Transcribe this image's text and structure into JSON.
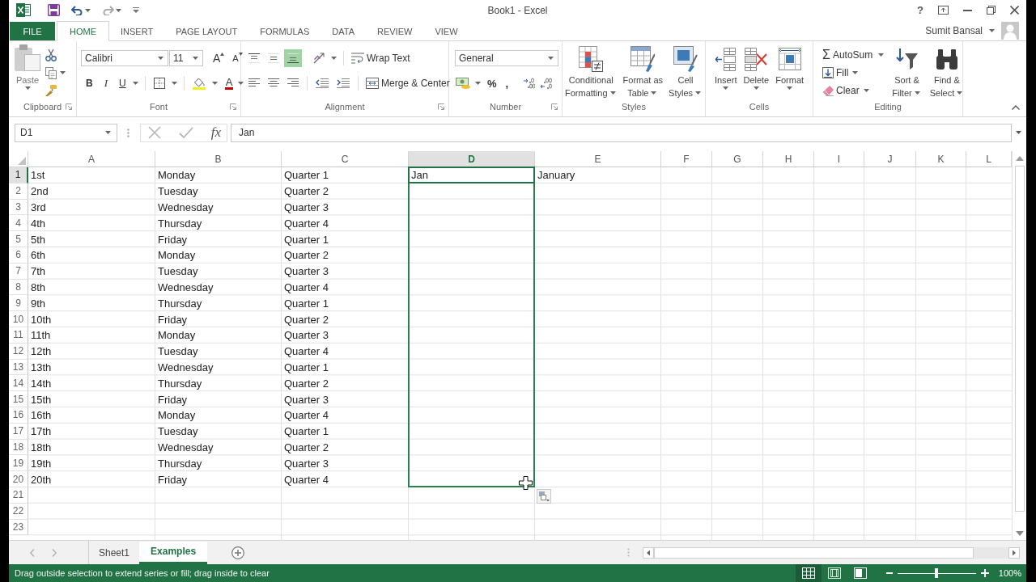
{
  "window": {
    "title": "Book1 - Excel",
    "help": "?"
  },
  "tabs": [
    {
      "label": "FILE",
      "kind": "file",
      "selected": false
    },
    {
      "label": "HOME",
      "kind": "tab",
      "selected": true
    },
    {
      "label": "INSERT",
      "kind": "tab",
      "selected": false
    },
    {
      "label": "PAGE LAYOUT",
      "kind": "tab",
      "selected": false
    },
    {
      "label": "FORMULAS",
      "kind": "tab",
      "selected": false
    },
    {
      "label": "DATA",
      "kind": "tab",
      "selected": false
    },
    {
      "label": "REVIEW",
      "kind": "tab",
      "selected": false
    },
    {
      "label": "VIEW",
      "kind": "tab",
      "selected": false
    }
  ],
  "account": {
    "name": "Sumit Bansal"
  },
  "ribbon": {
    "clipboard": {
      "label": "Clipboard",
      "paste": "Paste"
    },
    "font": {
      "label": "Font",
      "font_name": "Calibri",
      "font_size": "11",
      "grow": "A",
      "shrink": "A",
      "styles": [
        "B",
        "I",
        "U"
      ],
      "font_color": "A"
    },
    "alignment": {
      "label": "Alignment",
      "vertical": [
        {
          "kind": "top",
          "selected": false
        },
        {
          "kind": "middle",
          "selected": false
        },
        {
          "kind": "bottom",
          "selected": true
        }
      ],
      "horizontal": [
        {
          "kind": "left",
          "selected": false
        },
        {
          "kind": "center",
          "selected": false
        },
        {
          "kind": "right",
          "selected": false
        }
      ],
      "wrap_text": "Wrap Text",
      "merge": "Merge & Center"
    },
    "number": {
      "label": "Number",
      "format": "General",
      "percent": "%",
      "comma": ","
    },
    "styles": {
      "label": "Styles",
      "buttons": [
        {
          "kind": "conditional",
          "lines": [
            "Conditional",
            "Formatting"
          ]
        },
        {
          "kind": "table",
          "lines": [
            "Format as",
            "Table"
          ]
        },
        {
          "kind": "cell_styles",
          "lines": [
            "Cell",
            "Styles"
          ]
        }
      ]
    },
    "cells": {
      "label": "Cells",
      "buttons": [
        {
          "kind": "insert",
          "label": "Insert"
        },
        {
          "kind": "delete",
          "label": "Delete"
        },
        {
          "kind": "format",
          "label": "Format"
        }
      ]
    },
    "editing": {
      "label": "Editing",
      "autosum": {
        "symbol": "Σ",
        "label": "AutoSum"
      },
      "fill": "Fill",
      "clear": "Clear",
      "buttons": [
        {
          "kind": "sort",
          "lines": [
            "Sort &",
            "Filter"
          ]
        },
        {
          "kind": "find",
          "lines": [
            "Find &",
            "Select"
          ]
        }
      ]
    }
  },
  "formula_bar": {
    "name_box": "D1",
    "function_label": "fx",
    "value": "Jan"
  },
  "sheet": {
    "fill_drag": true,
    "columns": [
      {
        "header": "A",
        "selected": false
      },
      {
        "header": "B",
        "selected": false
      },
      {
        "header": "C",
        "selected": false
      },
      {
        "header": "D",
        "selected": true
      },
      {
        "header": "E",
        "selected": false
      },
      {
        "header": "F",
        "selected": false
      },
      {
        "header": "G",
        "selected": false
      },
      {
        "header": "H",
        "selected": false
      },
      {
        "header": "I",
        "selected": false
      },
      {
        "header": "J",
        "selected": false
      },
      {
        "header": "K",
        "selected": false
      },
      {
        "header": "L",
        "selected": false
      }
    ],
    "rows": [
      {
        "header": "1",
        "selected": true,
        "cells": [
          "1st",
          "Monday",
          "Quarter 1",
          "Jan",
          "January"
        ]
      },
      {
        "header": "2",
        "selected": false,
        "cells": [
          "2nd",
          "Tuesday",
          "Quarter 2"
        ]
      },
      {
        "header": "3",
        "selected": false,
        "cells": [
          "3rd",
          "Wednesday",
          "Quarter 3"
        ]
      },
      {
        "header": "4",
        "selected": false,
        "cells": [
          "4th",
          "Thursday",
          "Quarter 4"
        ]
      },
      {
        "header": "5",
        "selected": false,
        "cells": [
          "5th",
          "Friday",
          "Quarter 1"
        ]
      },
      {
        "header": "6",
        "selected": false,
        "cells": [
          "6th",
          "Monday",
          "Quarter 2"
        ]
      },
      {
        "header": "7",
        "selected": false,
        "cells": [
          "7th",
          "Tuesday",
          "Quarter 3"
        ]
      },
      {
        "header": "8",
        "selected": false,
        "cells": [
          "8th",
          "Wednesday",
          "Quarter 4"
        ]
      },
      {
        "header": "9",
        "selected": false,
        "cells": [
          "9th",
          "Thursday",
          "Quarter 1"
        ]
      },
      {
        "header": "10",
        "selected": false,
        "cells": [
          "10th",
          "Friday",
          "Quarter 2"
        ]
      },
      {
        "header": "11",
        "selected": false,
        "cells": [
          "11th",
          "Monday",
          "Quarter 3"
        ]
      },
      {
        "header": "12",
        "selected": false,
        "cells": [
          "12th",
          "Tuesday",
          "Quarter 4"
        ]
      },
      {
        "header": "13",
        "selected": false,
        "cells": [
          "13th",
          "Wednesday",
          "Quarter 1"
        ]
      },
      {
        "header": "14",
        "selected": false,
        "cells": [
          "14th",
          "Thursday",
          "Quarter 2"
        ]
      },
      {
        "header": "15",
        "selected": false,
        "cells": [
          "15th",
          "Friday",
          "Quarter 3"
        ]
      },
      {
        "header": "16",
        "selected": false,
        "cells": [
          "16th",
          "Monday",
          "Quarter 4"
        ]
      },
      {
        "header": "17",
        "selected": false,
        "cells": [
          "17th",
          "Tuesday",
          "Quarter 1"
        ]
      },
      {
        "header": "18",
        "selected": false,
        "cells": [
          "18th",
          "Wednesday",
          "Quarter 2"
        ]
      },
      {
        "header": "19",
        "selected": false,
        "cells": [
          "19th",
          "Thursday",
          "Quarter 3"
        ]
      },
      {
        "header": "20",
        "selected": false,
        "cells": [
          "20th",
          "Friday",
          "Quarter 4"
        ]
      },
      {
        "header": "21",
        "selected": false
      },
      {
        "header": "22",
        "selected": false
      },
      {
        "header": "23",
        "selected": false
      }
    ]
  },
  "sheet_tabs": [
    {
      "label": "Sheet1",
      "selected": false
    },
    {
      "label": "Examples",
      "selected": true
    }
  ],
  "status_bar": {
    "message": "Drag outside selection to extend series or fill; drag inside to clear",
    "views": [
      {
        "kind": "normal",
        "selected": true
      },
      {
        "kind": "page_layout",
        "selected": false
      },
      {
        "kind": "page_break",
        "selected": false
      }
    ],
    "zoom": {
      "level": 0.5,
      "reading": "100%"
    }
  }
}
